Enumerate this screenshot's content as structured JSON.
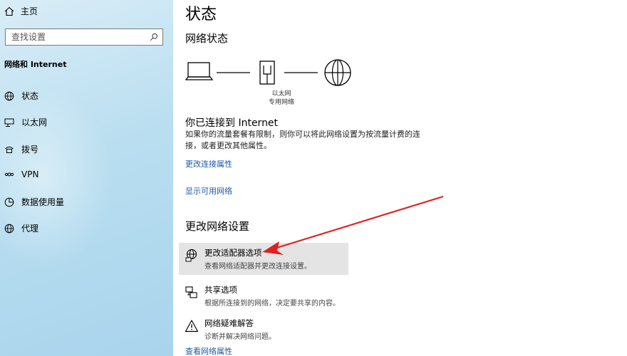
{
  "sidebar": {
    "home_label": "主页",
    "search_placeholder": "查找设置",
    "section_title": "网络和 Internet",
    "items": [
      {
        "label": "状态",
        "icon": "globe-icon"
      },
      {
        "label": "以太网",
        "icon": "ethernet-icon"
      },
      {
        "label": "拨号",
        "icon": "dialup-icon"
      },
      {
        "label": "VPN",
        "icon": "vpn-icon"
      },
      {
        "label": "数据使用量",
        "icon": "data-usage-icon"
      },
      {
        "label": "代理",
        "icon": "proxy-globe-icon"
      }
    ]
  },
  "main": {
    "title": "状态",
    "network_status_heading": "网络状态",
    "diagram": {
      "adapter_label": "以太网",
      "network_label": "专用网络"
    },
    "connected_heading": "你已连接到 Internet",
    "connected_desc": "如果你的流量套餐有限制，则你可以将此网络设置为按流量计费的连接，或者更改其他属性。",
    "link_change_properties": "更改连接属性",
    "link_show_networks": "显示可用网络",
    "change_settings_heading": "更改网络设置",
    "options": [
      {
        "title": "更改适配器选项",
        "desc": "查看网络适配器并更改连接设置。",
        "icon": "adapter-icon"
      },
      {
        "title": "共享选项",
        "desc": "根据所连接到的网络，决定要共享的内容。",
        "icon": "sharing-icon"
      },
      {
        "title": "网络疑难解答",
        "desc": "诊断并解决网络问题。",
        "icon": "warning-icon"
      }
    ],
    "link_view_properties": "查看网络属性"
  },
  "colors": {
    "link": "#1a5aa7",
    "arrow": "#e02020",
    "highlight": "#e4e4e4"
  }
}
